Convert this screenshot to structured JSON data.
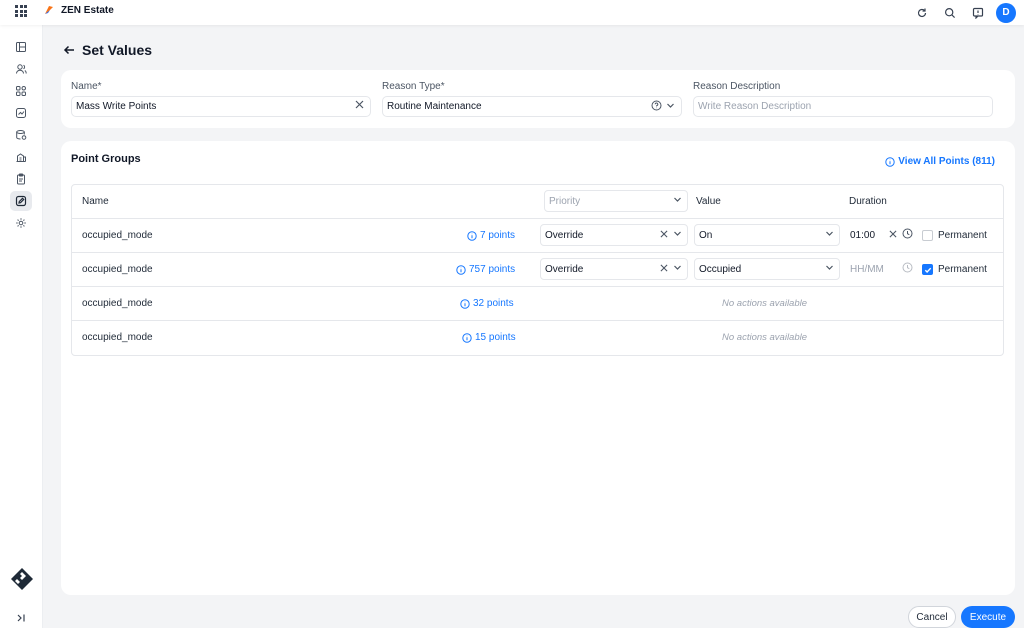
{
  "app": {
    "name": "ZEN Estate",
    "user_initial": "D",
    "accent": "#1677ff"
  },
  "topbar": {
    "icons": [
      "refresh-icon",
      "search-icon",
      "feedback-icon"
    ]
  },
  "sidebar": {
    "icons": [
      "dashboard-icon",
      "users-icon",
      "apps-icon",
      "analytics-icon",
      "database-icon",
      "building-icon",
      "clipboard-icon",
      "edit-icon",
      "settings-icon"
    ],
    "active": "edit-icon"
  },
  "page": {
    "title": "Set Values"
  },
  "form": {
    "name_label": "Name*",
    "name_value": "Mass Write Points",
    "reason_type_label": "Reason Type*",
    "reason_type_value": "Routine Maintenance",
    "reason_desc_label": "Reason Description",
    "reason_desc_placeholder": "Write Reason Description"
  },
  "point_groups": {
    "title": "Point Groups",
    "view_all": "View All Points (811)",
    "columns": {
      "name": "Name",
      "priority_placeholder": "Priority",
      "value": "Value",
      "duration": "Duration"
    },
    "rows": [
      {
        "name": "occupied_mode",
        "points": "7 points",
        "priority": "Override",
        "value": "On",
        "duration": "01:00",
        "permanent_label": "Permanent",
        "permanent": false
      },
      {
        "name": "occupied_mode",
        "points": "757 points",
        "priority": "Override",
        "value": "Occupied",
        "duration_placeholder": "HH/MM",
        "permanent_label": "Permanent",
        "permanent": true
      },
      {
        "name": "occupied_mode",
        "points": "32 points",
        "no_actions": "No actions available"
      },
      {
        "name": "occupied_mode",
        "points": "15 points",
        "no_actions": "No actions available"
      }
    ]
  },
  "footer": {
    "cancel": "Cancel",
    "execute": "Execute"
  }
}
